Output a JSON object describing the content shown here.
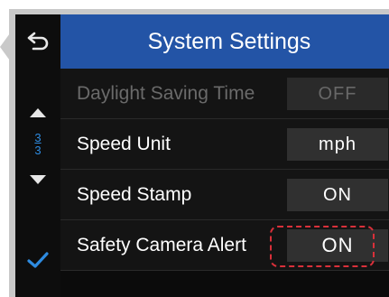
{
  "header": {
    "title": "System Settings"
  },
  "sidebar": {
    "icons": [
      "back-arrow-icon",
      "up-arrow-icon",
      "down-arrow-icon",
      "checkmark-icon"
    ],
    "page_current": "3",
    "page_total": "3"
  },
  "settings": [
    {
      "label": "Daylight Saving Time",
      "value": "OFF",
      "state": "disabled"
    },
    {
      "label": "Speed Unit",
      "value": "mph",
      "state": "enabled"
    },
    {
      "label": "Speed Stamp",
      "value": "ON",
      "state": "enabled"
    },
    {
      "label": "Safety Camera Alert",
      "value": "ON",
      "state": "selected"
    }
  ],
  "colors": {
    "header_bg": "#2354a6",
    "accent_blue": "#2e8be0",
    "highlight_red": "#d9303a",
    "row_bg": "#141414",
    "value_bg": "#303030"
  }
}
